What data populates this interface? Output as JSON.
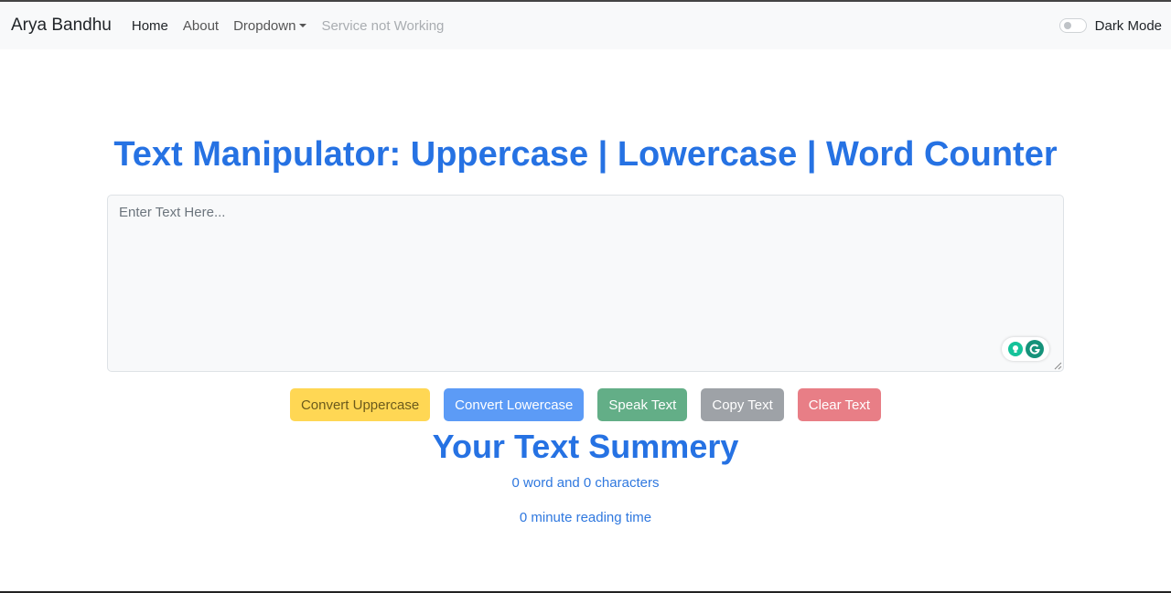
{
  "navbar": {
    "brand": "Arya Bandhu",
    "links": [
      {
        "label": "Home"
      },
      {
        "label": "About"
      },
      {
        "label": "Dropdown"
      },
      {
        "label": "Service not Working"
      }
    ],
    "dark_mode_label": "Dark Mode",
    "dark_mode_on": false
  },
  "main": {
    "title": "Text Manipulator: Uppercase | Lowercase | Word Counter",
    "textarea_placeholder": "Enter Text Here...",
    "textarea_value": "",
    "buttons": {
      "uppercase": "Convert Uppercase",
      "lowercase": "Convert Lowercase",
      "speak": "Speak Text",
      "copy": "Copy Text",
      "clear": "Clear Text"
    }
  },
  "summary": {
    "title": "Your Text Summery",
    "counts": "0 word and 0 characters",
    "reading_time": "0 minute reading time"
  },
  "colors": {
    "accent": "#2672e3",
    "navbar_bg": "#f8f9fa",
    "btn_warning": "#ffd754",
    "btn_primary": "#5c9bf6",
    "btn_success": "#63ae87",
    "btn_secondary": "#9ea2a7",
    "btn_danger": "#e87e86"
  },
  "icons": {
    "grammarly_suggestion": "lightbulb-icon",
    "grammarly_logo": "grammarly-g-icon",
    "dropdown": "caret-down-icon",
    "resize": "resize-grip-icon"
  }
}
